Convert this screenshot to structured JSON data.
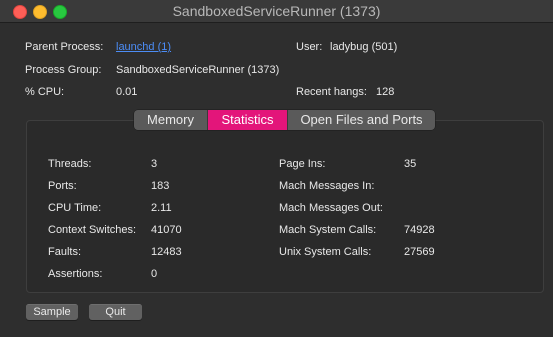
{
  "window": {
    "title": "SandboxedServiceRunner (1373)"
  },
  "info": {
    "parent_process_label": "Parent Process:",
    "parent_process_value": "launchd (1)",
    "user_label": "User:",
    "user_value": "ladybug (501)",
    "process_group_label": "Process Group:",
    "process_group_value": "SandboxedServiceRunner (1373)",
    "cpu_label": "% CPU:",
    "cpu_value": "0.01",
    "recent_hangs_label": "Recent hangs:",
    "recent_hangs_value": "128"
  },
  "tabs": [
    {
      "label": "Memory",
      "selected": false
    },
    {
      "label": "Statistics",
      "selected": true
    },
    {
      "label": "Open Files and Ports",
      "selected": false
    }
  ],
  "stats": {
    "left": [
      {
        "label": "Threads:",
        "value": "3"
      },
      {
        "label": "Ports:",
        "value": "183"
      },
      {
        "label": "CPU Time:",
        "value": "2.11"
      },
      {
        "label": "Context Switches:",
        "value": "41070"
      },
      {
        "label": "Faults:",
        "value": "12483"
      },
      {
        "label": "Assertions:",
        "value": "0"
      }
    ],
    "right": [
      {
        "label": "Page Ins:",
        "value": "35"
      },
      {
        "label": "Mach Messages In:",
        "value": ""
      },
      {
        "label": "Mach Messages Out:",
        "value": ""
      },
      {
        "label": "Mach System Calls:",
        "value": "74928"
      },
      {
        "label": "Unix System Calls:",
        "value": "27569"
      }
    ]
  },
  "buttons": {
    "sample_label": "Sample",
    "quit_label": "Quit"
  },
  "colors": {
    "accent": "#e3157a",
    "link": "#4c8df6",
    "background": "#2e2e2e"
  }
}
